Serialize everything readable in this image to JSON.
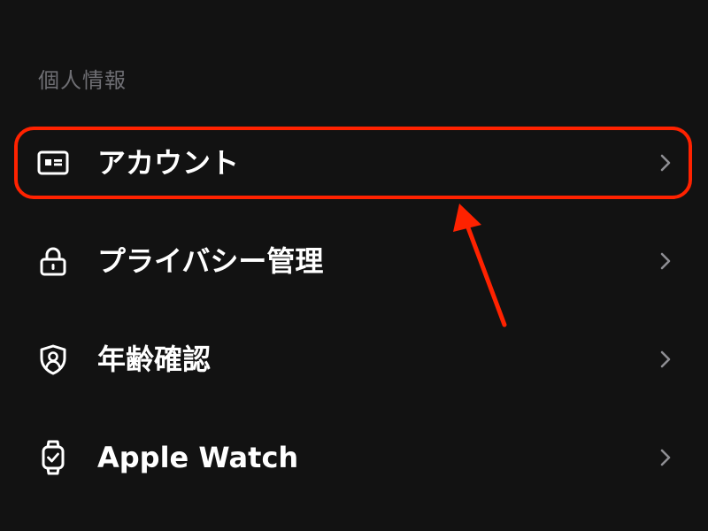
{
  "section": {
    "title": "個人情報"
  },
  "items": [
    {
      "label": "アカウント",
      "icon": "id-card-icon"
    },
    {
      "label": "プライバシー管理",
      "icon": "lock-icon"
    },
    {
      "label": "年齢確認",
      "icon": "shield-person-icon"
    },
    {
      "label": "Apple Watch",
      "icon": "apple-watch-icon"
    }
  ],
  "colors": {
    "background": "#121212",
    "text": "#ffffff",
    "section_header": "#6e6e73",
    "chevron": "#8e8e93",
    "annotation": "#ff2200"
  }
}
